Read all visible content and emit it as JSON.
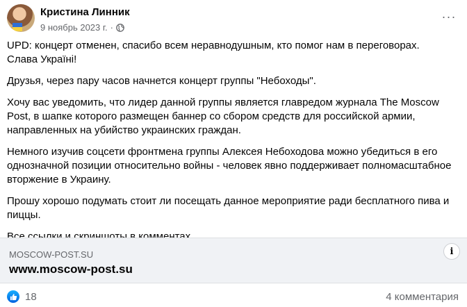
{
  "post": {
    "author": "Кристина Линник",
    "date": "9 ноябрь 2023 г.",
    "separator": "·",
    "privacy_icon": "globe-icon",
    "more_icon": "more-options-icon",
    "more_label": "···",
    "paragraphs": [
      "UPD: концерт отменен, спасибо всем неравнодушным, кто помог нам в переговорах.",
      "Слава Україні!",
      "Друзья, через пару часов начнется концерт группы \"Небоходы\".",
      "Хочу вас уведомить, что лидер данной группы является главредом журнала The Moscow Post, в шапке которого размещен баннер со сбором средств для российской армии, направленных на убийство украинских граждан.",
      "Немного изучив соцсети фронтмена группы Алексея Небоходова можно убедиться в его однозначной позиции относительно войны - человек явно поддерживает полномасштабное вторжение в Украину.",
      "Прошу хорошо подумать стоит ли посещать данное мероприятие ради бесплатного пива и пиццы.",
      "Все ссылки и скриншоты в комментах"
    ]
  },
  "link_preview": {
    "domain": "MOSCOW-POST.SU",
    "title": "www.moscow-post.su",
    "info_label": "i"
  },
  "footer": {
    "reaction_icon": "like-icon",
    "reaction_count": "18",
    "comments": "4 комментария"
  },
  "colors": {
    "secondary_text": "#65676b",
    "like_blue": "#0866ff",
    "card_background": "#f0f2f5"
  }
}
